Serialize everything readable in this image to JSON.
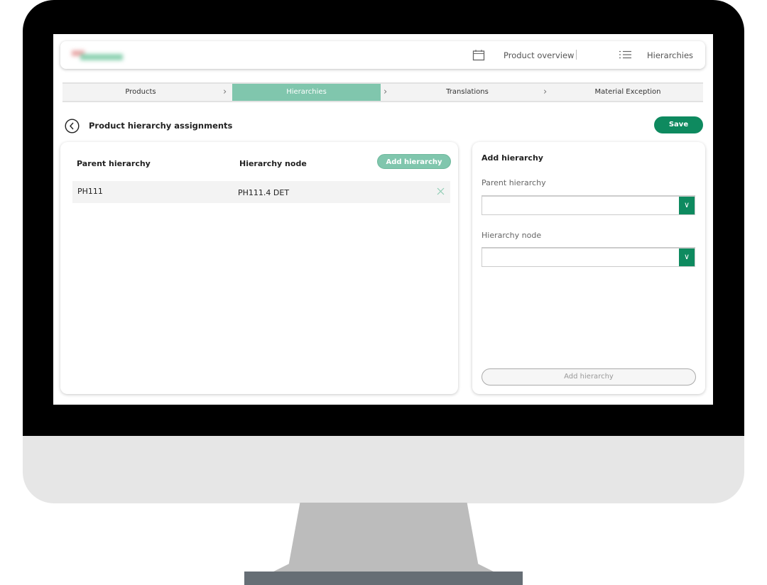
{
  "header": {
    "nav": [
      {
        "icon": "calendar-icon",
        "label": "Product overview"
      },
      {
        "icon": "list-icon",
        "label": "Hierarchies"
      }
    ]
  },
  "steps": [
    {
      "label": "Products",
      "active": false
    },
    {
      "label": "Hierarchies",
      "active": true
    },
    {
      "label": "Translations",
      "active": false
    },
    {
      "label": "Material Exception",
      "active": false
    }
  ],
  "page": {
    "title": "Product hierarchy assignments",
    "save_label": "Save"
  },
  "table": {
    "columns": [
      "Parent hierarchy",
      "Hierarchy node"
    ],
    "add_label": "Add hierarchy",
    "rows": [
      {
        "parent": "PH111",
        "node": "PH111.4 DET"
      }
    ]
  },
  "form": {
    "title": "Add hierarchy",
    "parent_label": "Parent hierarchy",
    "parent_value": "",
    "node_label": "Hierarchy node",
    "node_value": "",
    "submit_label": "Add hierarchy"
  },
  "colors": {
    "accent": "#0e8a5f",
    "active_step": "#80c6ad"
  }
}
